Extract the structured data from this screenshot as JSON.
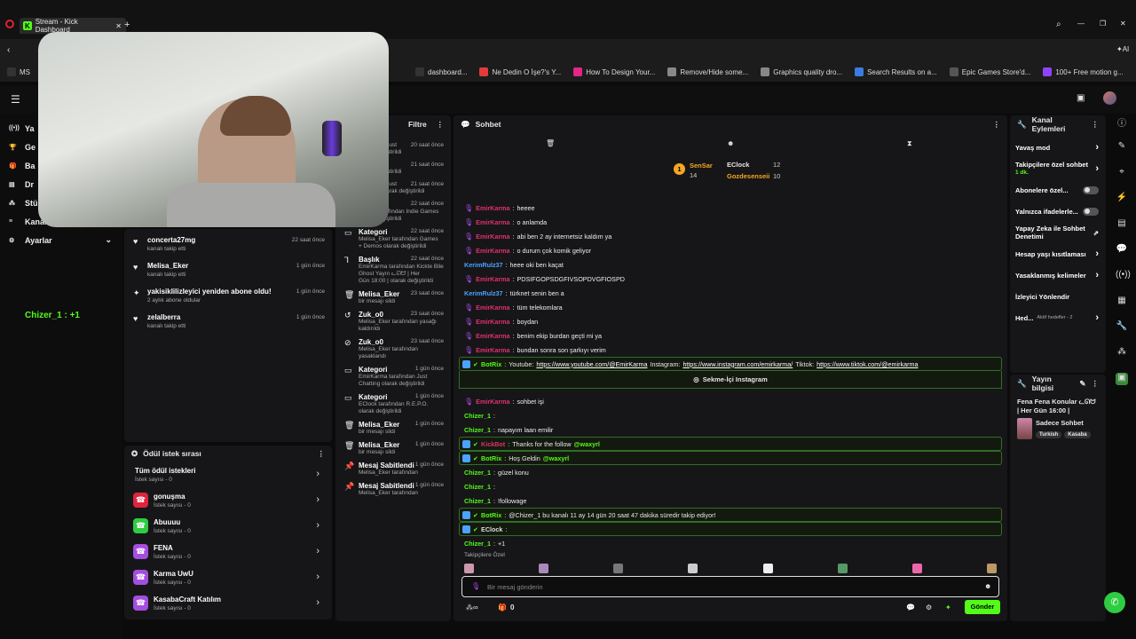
{
  "browser": {
    "tab_title": "Stream - Kick Dashboard",
    "bookmarks": [
      {
        "label": "MS",
        "color": "#333"
      },
      {
        "label": "dashboard...",
        "color": "#333"
      },
      {
        "label": "Ne Dedin O İşe?'s Y...",
        "color": "#e23b3b"
      },
      {
        "label": "How To Design Your...",
        "color": "#e4258a"
      },
      {
        "label": "Remove/Hide some...",
        "color": "#888"
      },
      {
        "label": "Graphics quality dro...",
        "color": "#888"
      },
      {
        "label": "Search Results on a...",
        "color": "#3b7be2"
      },
      {
        "label": "Epic Games Store'd...",
        "color": "#555"
      },
      {
        "label": "100+ Free motion g...",
        "color": "#8e44ff"
      }
    ]
  },
  "left_nav": {
    "items": [
      {
        "label": "Ya",
        "icon": "broadcast-icon"
      },
      {
        "label": "Ge",
        "icon": "trophy-icon"
      },
      {
        "label": "Ba",
        "icon": "gift-icon"
      },
      {
        "label": "Dr",
        "icon": "drops-icon"
      },
      {
        "label": "Stü",
        "icon": "studio-icon"
      },
      {
        "label": "Kanal",
        "icon": "channel-icon"
      },
      {
        "label": "Ayarlar",
        "icon": "gear-icon"
      }
    ],
    "overlay_text": "Chizer_1 : +1"
  },
  "activity": {
    "rows": [
      {
        "title": "concerta27mg",
        "sub": "kanalı takip etti",
        "time": "22 saat önce",
        "icon": "heart"
      },
      {
        "title": "Melisa_Eker",
        "sub": "kanalı takip etti",
        "time": "1 gün önce",
        "icon": "heart"
      },
      {
        "title": "yakisiklilizleyici yeniden abone oldu!",
        "sub": "2 aylık abone oldular",
        "time": "1 gün önce",
        "icon": "star"
      },
      {
        "title": "zelalberra",
        "sub": "kanalı takip etti",
        "time": "1 gün önce",
        "icon": "heart"
      }
    ]
  },
  "rewards": {
    "title": "Ödül istek sırası",
    "all_label": "Tüm ödül istekleri",
    "all_sub": "İstek sayısı - 0",
    "items": [
      {
        "name": "gonuşma",
        "sub": "İstek sayısı - 0",
        "color": "#e0233c"
      },
      {
        "name": "Abuuuu",
        "sub": "İstek sayısı - 0",
        "color": "#2ecc40"
      },
      {
        "name": "FENA",
        "sub": "İstek sayısı - 0",
        "color": "#a44ee0"
      },
      {
        "name": "Karma UwU",
        "sub": "İstek sayısı - 0",
        "color": "#a44ee0"
      },
      {
        "name": "KasabaCraft Katılım",
        "sub": "İstek sayısı - 0",
        "color": "#a44ee0"
      }
    ]
  },
  "modlog": {
    "filter_label": "Filtre",
    "rows": [
      {
        "title": "",
        "time": "20 saat önce",
        "l1": "tarafından Just",
        "l2": "olarak değiştirildi",
        "icon": ""
      },
      {
        "title": "",
        "time": "21 saat önce",
        "l1": "tarafından",
        "l2": "olarak değiştirildi",
        "icon": ""
      },
      {
        "title": "",
        "time": "21 saat önce",
        "l1": "tarafından Just",
        "l2": "Chatting olarak değiştirildi",
        "icon": ""
      },
      {
        "title": "Kategori",
        "time": "22 saat önce",
        "l1": "EClock tarafından Indie Games",
        "l2": "olarak değiştirildi",
        "icon": "folder-icon"
      },
      {
        "title": "Kategori",
        "time": "22 saat önce",
        "l1": "Melisa_Eker tarafından Games",
        "l2": "+ Demos olarak değiştirildi",
        "icon": "folder-icon"
      },
      {
        "title": "Başlık",
        "time": "22 saat önce",
        "l1": "EmirKarma tarafından Kickte Bile Ghost Yayın ᓚᘏᗢ | Her",
        "l2": "Gün 18:00 | olarak değiştirildi",
        "icon": "text-icon"
      },
      {
        "title": "Melisa_Eker",
        "time": "23 saat önce",
        "l1": "bir mesajı sildi",
        "l2": "",
        "icon": "trash-icon"
      },
      {
        "title": "Zuk_o0",
        "time": "23 saat önce",
        "l1": "Melisa_Eker tarafından yasağı",
        "l2": "kaldırıldı",
        "icon": "undo-icon"
      },
      {
        "title": "Zuk_o0",
        "time": "23 saat önce",
        "l1": "Melisa_Eker tarafından",
        "l2": "yasaklandı",
        "icon": "ban-icon"
      },
      {
        "title": "Kategori",
        "time": "1 gün önce",
        "l1": "EmirKarma tarafından Just",
        "l2": "Chatting olarak değiştirildi",
        "icon": "folder-icon"
      },
      {
        "title": "Kategori",
        "time": "1 gün önce",
        "l1": "EClock tarafından R.E.P.O.",
        "l2": "olarak değiştirildi",
        "icon": "folder-icon"
      },
      {
        "title": "Melisa_Eker",
        "time": "1 gün önce",
        "l1": "bir mesajı sildi",
        "l2": "",
        "icon": "trash-icon"
      },
      {
        "title": "Melisa_Eker",
        "time": "1 gün önce",
        "l1": "bir mesajı sildi",
        "l2": "",
        "icon": "trash-icon"
      },
      {
        "title": "Mesaj Sabitlendi",
        "time": "1 gün önce",
        "l1": "Melisa_Eker tarafından",
        "l2": "",
        "icon": "pin-icon"
      },
      {
        "title": "Mesaj Sabitlendi",
        "time": "1 gün önce",
        "l1": "Melisa_Eker tarafından",
        "l2": "",
        "icon": "pin-icon"
      }
    ]
  },
  "chat": {
    "title": "Sohbet",
    "top": {
      "u1": "SenSar",
      "n1": "14",
      "u2": "EClock",
      "n2": "12",
      "u3": "Gozdesenseii",
      "n3": "10"
    },
    "lines": [
      {
        "user": "EmirKarma",
        "text": "heeee",
        "kind": "red"
      },
      {
        "user": "EmirKarma",
        "text": "o anlamda",
        "kind": "red"
      },
      {
        "user": "EmirKarma",
        "text": "abi ben 2 ay internetsiz kaldım ya",
        "kind": "red"
      },
      {
        "user": "EmirKarma",
        "text": "o durum çok komik geliyor",
        "kind": "red"
      },
      {
        "user": "KerimRulz37",
        "text": "heee oki ben kaçat",
        "kind": "blue"
      },
      {
        "user": "EmirKarma",
        "text": "PDSIFGOPSDGFIVSOPDVGFIOSPD",
        "kind": "red"
      },
      {
        "user": "KerimRulz37",
        "text": "türknet senin ben a",
        "kind": "blue"
      },
      {
        "user": "EmirKarma",
        "text": "tüm telekomlara",
        "kind": "red"
      },
      {
        "user": "EmirKarma",
        "text": "boydan",
        "kind": "red"
      },
      {
        "user": "EmirKarma",
        "text": "benim ekip burdan geçti mi ya",
        "kind": "red"
      },
      {
        "user": "EmirKarma",
        "text": "bundan sonra son şarkıyı verim",
        "kind": "red"
      }
    ],
    "bot1": {
      "user": "BotRix",
      "pre": "Youtube:",
      "l1": "https://www.youtube.com/@EmirKarma",
      "mid1": "Instagram:",
      "l2": "https://www.instagram.com/emirkarma/",
      "mid2": "Tiktok:",
      "l3": "https://www.tiktok.com/@emirkarma",
      "button": "Sekme-İçi Instagram"
    },
    "lines2": [
      {
        "user": "EmirKarma",
        "text": "sohbet işi",
        "kind": "red"
      },
      {
        "user": "Chizer_1",
        "text": "",
        "kind": "green"
      },
      {
        "user": "Chizer_1",
        "text": "napayım laan emilir",
        "kind": "green"
      }
    ],
    "bot2": {
      "user": "KickBot",
      "text": "Thanks for the follow",
      "mention": "@waxyrl"
    },
    "bot3": {
      "user": "BotRix",
      "text": "Hoş Geldin",
      "mention": "@waxyrl"
    },
    "lines3": [
      {
        "user": "Chizer_1",
        "text": "güzel konu",
        "kind": "green"
      },
      {
        "user": "Chizer_1",
        "text": "",
        "kind": "green"
      },
      {
        "user": "Chizer_1",
        "text": "!followage",
        "kind": "green"
      }
    ],
    "bot4": {
      "user": "BotRix",
      "text": "@Chizer_1 bu kanalı 11 ay 14 gün 20 saat 47 dakika süredir takip ediyor!"
    },
    "eclock": {
      "user": "EClock"
    },
    "last": {
      "user": "Chizer_1",
      "text": "+1"
    },
    "followers_label": "Takipçilere Özel",
    "input_placeholder": "Bir mesaj gönderin",
    "count": "0",
    "send_label": "Gönder"
  },
  "channel_actions": {
    "title": "Kanal Eylemleri",
    "items": [
      {
        "label": "Yavaş mod",
        "type": "chev"
      },
      {
        "label": "Takipçilere özel sohbet",
        "sub": "1 dk.",
        "type": "chev"
      },
      {
        "label": "Abonelere özel...",
        "type": "toggle"
      },
      {
        "label": "Yalnızca ifadelerle...",
        "type": "toggle"
      },
      {
        "label": "Yapay Zeka ile Sohbet Denetimi",
        "type": "ext"
      },
      {
        "label": "Hesap yaşı kısıtlaması",
        "type": "chev"
      },
      {
        "label": "Yasaklanmış kelimeler",
        "type": "chev"
      },
      {
        "label": "İzleyici Yönlendir",
        "type": "none"
      },
      {
        "label": "Hed...",
        "sub2": "Aktif hedefler - 2",
        "type": "chev"
      }
    ]
  },
  "stream_info": {
    "title": "Yayın bilgisi",
    "stream_title": "Fena Fena Konular ᓚᘏᗢ | Her Gün 16:00 |",
    "category": "Sadece Sohbet",
    "tags": [
      "Turkish",
      "Kasaba"
    ]
  }
}
